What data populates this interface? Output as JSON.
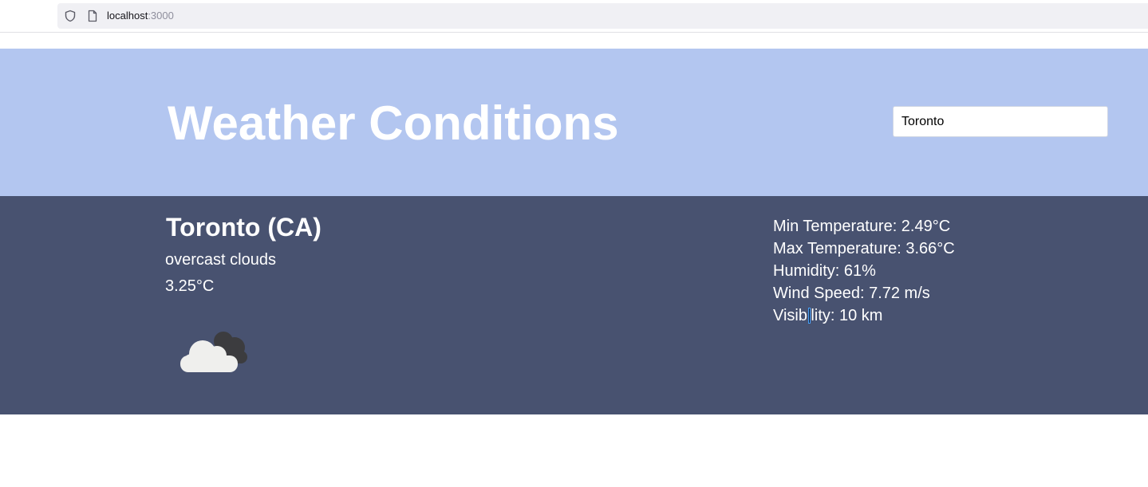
{
  "browser": {
    "url_host": "localhost",
    "url_port": ":3000",
    "icons": {
      "security": "shield-icon",
      "page": "page-icon",
      "bookmark": "bookmark-star-icon"
    }
  },
  "header": {
    "title": "Weather Conditions",
    "search_value": "Toronto",
    "background": "#b3c6f0"
  },
  "weather": {
    "city": "Toronto (CA)",
    "description": "overcast clouds",
    "temperature": "3.25°C",
    "icon": "overcast-clouds-icon",
    "background": "#485270",
    "stats": {
      "min_temp": "Min Temperature: 2.49°C",
      "max_temp": "Max Temperature: 3.66°C",
      "humidity": "Humidity: 61%",
      "wind_speed": "Wind Speed: 7.72 m/s",
      "visibility": "Visibility: 10 km"
    }
  }
}
